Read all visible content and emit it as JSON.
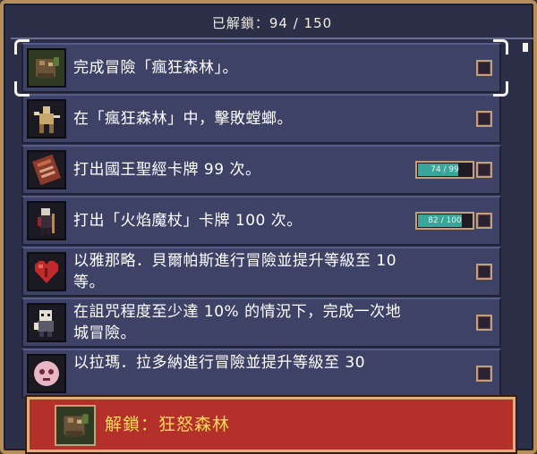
{
  "header": {
    "title": "已解鎖：94 / 150"
  },
  "achievements": [
    {
      "icon": "forest-creature-icon",
      "text": "完成冒險「瘋狂森林」。",
      "progress": null,
      "completed": false
    },
    {
      "icon": "mantis-warrior-icon",
      "text": "在「瘋狂森林」中，擊敗螳螂。",
      "progress": null,
      "completed": false
    },
    {
      "icon": "king-bible-icon",
      "text": "打出國王聖經卡牌 99 次。",
      "progress": {
        "label": "74 / 99",
        "current": 74,
        "max": 99
      },
      "completed": false
    },
    {
      "icon": "flame-staff-icon",
      "text": "打出「火焰魔杖」卡牌 100 次。",
      "progress": {
        "label": "82 / 100",
        "current": 82,
        "max": 100
      },
      "completed": false
    },
    {
      "icon": "red-heart-icon",
      "text": "以雅那略．貝爾帕斯進行冒險並提升等級至 10 等。",
      "progress": null,
      "completed": false
    },
    {
      "icon": "cursed-skull-icon",
      "text": "在詛咒程度至少達 10% 的情況下，完成一次地城冒險。",
      "progress": null,
      "completed": false
    },
    {
      "icon": "ghost-face-icon",
      "text": "以拉瑪．拉多納進行冒險並提升等級至 30",
      "progress": null,
      "completed": false
    }
  ],
  "unlock_banner": {
    "icon": "forest-creature-icon",
    "text": "解鎖：狂怒森林"
  },
  "colors": {
    "panel": "#2c2f48",
    "row": "#3e4266",
    "border": "#b58e5a",
    "progress_fill": "#3aa59a",
    "banner": "#b3302b",
    "banner_text": "#ffd95a"
  }
}
